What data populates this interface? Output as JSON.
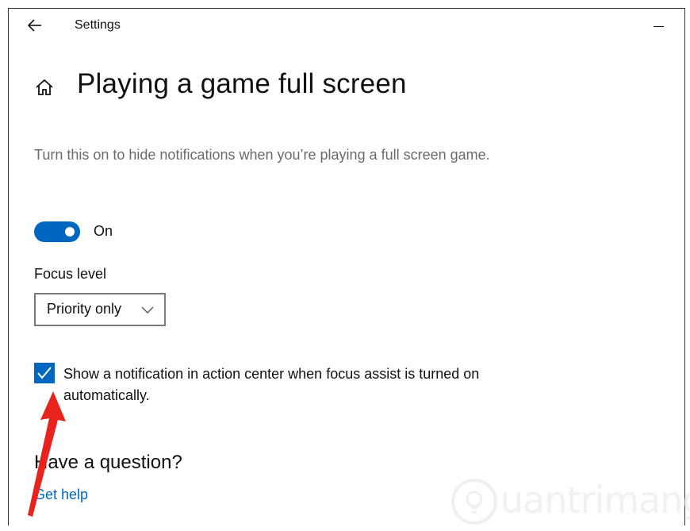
{
  "window": {
    "title": "Settings"
  },
  "header": {
    "page_title": "Playing a game full screen"
  },
  "description": "Turn this on to hide notifications when you’re playing a full screen game.",
  "toggle": {
    "state": "On",
    "on": true
  },
  "focus_level": {
    "label": "Focus level",
    "selected": "Priority only"
  },
  "checkbox": {
    "checked": true,
    "label": "Show a notification in action center when focus assist is turned on automatically."
  },
  "help": {
    "heading": "Have a question?",
    "link": "Get help"
  },
  "watermark": {
    "text": "uantrimang"
  },
  "colors": {
    "accent": "#0067c0",
    "annotation": "#e8231e",
    "description_text": "#6a6a6a"
  },
  "icons": {
    "back": "back-arrow-icon",
    "minimize": "minimize-icon",
    "home": "home-icon",
    "chevron": "chevron-down-icon",
    "check": "checkmark-icon"
  }
}
